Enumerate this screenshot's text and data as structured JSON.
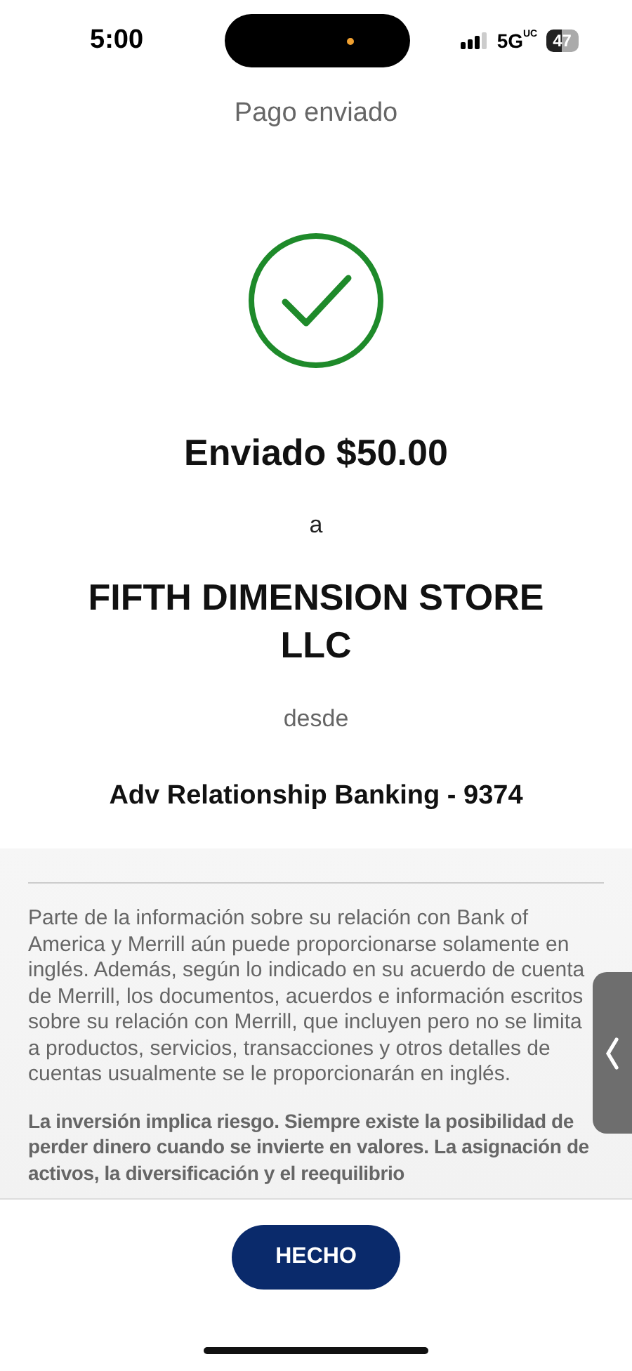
{
  "status_bar": {
    "time": "5:00",
    "network": "5G",
    "network_sub": "UC",
    "battery": "47"
  },
  "header": {
    "title": "Pago enviado"
  },
  "confirmation": {
    "amount_line": "Enviado $50.00",
    "to_label": "a",
    "recipient": "FIFTH DIMENSION STORE LLC",
    "from_label": "desde",
    "account": "Adv Relationship Banking - 9374"
  },
  "disclosures": [
    {
      "kind": "plain",
      "text": "Parte de la información sobre su relación con Bank of America y Merrill aún puede proporcionarse solamente en inglés. Además, según lo indicado en su acuerdo de cuenta de Merrill, los documentos, acuerdos e información escritos sobre su relación con Merrill, que incluyen pero no se limita a productos, servicios, transacciones y otros detalles de cuentas usualmente se le proporcionarán en inglés."
    },
    {
      "kind": "bold",
      "text": "La inversión implica riesgo. Siempre existe la posibilidad de perder dinero cuando se invierte en valores. La asignación de activos, la diversificación y el reequilibrio"
    }
  ],
  "footer": {
    "button": "HECHO"
  }
}
